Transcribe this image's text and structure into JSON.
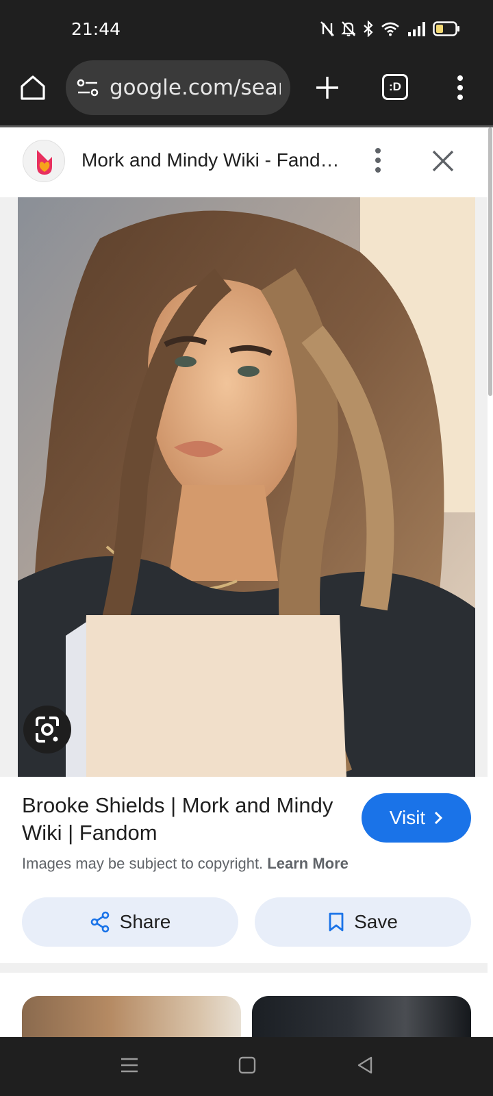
{
  "status_bar": {
    "time": "21:44",
    "icons": [
      "nfc-icon",
      "mute-icon",
      "bluetooth-icon",
      "wifi-icon",
      "signal-icon",
      "battery-icon"
    ]
  },
  "browser": {
    "url": "google.com/search",
    "tabs_label": ":D",
    "icons": [
      "home-icon",
      "tune-icon",
      "plus-icon",
      "tabs-icon",
      "more-vert-icon"
    ]
  },
  "sheet": {
    "site_title": "Mork and Mindy Wiki - Fandom",
    "result_title": "Brooke Shields | Mork and Mindy Wiki | Fandom",
    "visit_label": "Visit",
    "copyright_text": "Images may be subject to copyright.",
    "learn_more_label": "Learn More",
    "share_label": "Share",
    "save_label": "Save"
  },
  "colors": {
    "accent": "#1a73e8",
    "action_bg": "#e8eef9",
    "bar_bg": "#1f1f1f",
    "fandom_pink": "#e8305f",
    "fandom_orange": "#f7a21b"
  }
}
